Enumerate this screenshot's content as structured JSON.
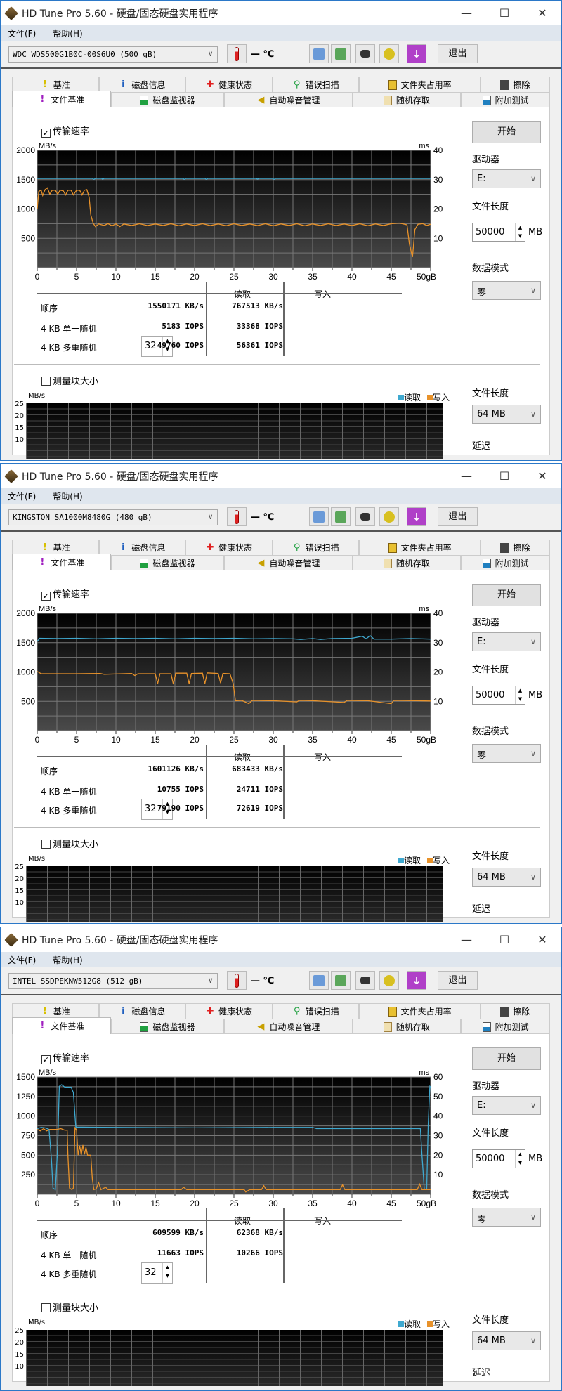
{
  "app": {
    "title": "HD Tune Pro 5.60 - 硬盘/固态硬盘实用程序",
    "menu": {
      "file": "文件(F)",
      "help": "帮助(H)"
    },
    "window_controls": {
      "minimize": "—",
      "maximize": "☐",
      "close": "✕"
    },
    "temperature": "— ℃",
    "exit": "退出",
    "tabs_row1": [
      "基准",
      "磁盘信息",
      "健康状态",
      "错误扫描",
      "文件夹占用率",
      "擦除"
    ],
    "tabs_row2": [
      "文件基准",
      "磁盘监视器",
      "自动噪音管理",
      "随机存取",
      "附加测试"
    ],
    "transfer_rate_label": "传输速率",
    "start": "开始",
    "drive_label": "驱动器",
    "drive_value": "E:",
    "file_length_label": "文件长度",
    "file_length_value": "50000",
    "file_length_unit": "MB",
    "data_mode_label": "数据模式",
    "data_mode_value": "零",
    "col_read": "读取",
    "col_write": "写入",
    "row_labels": [
      "顺序",
      "4 KB 单一随机",
      "4 KB 多重随机"
    ],
    "queue_depth": "32",
    "block_size_label": "测量块大小",
    "block_ylabel": "MB/s",
    "block_yticks": [
      "25",
      "20",
      "15",
      "10"
    ],
    "legend_read": "读取",
    "legend_write": "写入",
    "block_file_length": "64 MB",
    "latency_label": "延迟",
    "colors": {
      "read": "#3fa9d0",
      "write": "#e8922a",
      "border": "#2b78c8"
    }
  },
  "windows": [
    {
      "drive": "WDC WDS500G1B0C-00S6U0 (500 gB)",
      "seq_read": "1550171 KB/s",
      "seq_write": "767513 KB/s",
      "r4k_read": "5183 IOPS",
      "r4k_write": "33368 IOPS",
      "r4kq_read": "49760 IOPS",
      "r4kq_write": "56361 IOPS"
    },
    {
      "drive": "KINGSTON SA1000M8480G (480 gB)",
      "seq_read": "1601126 KB/s",
      "seq_write": "683433 KB/s",
      "r4k_read": "10755 IOPS",
      "r4k_write": "24711 IOPS",
      "r4kq_read": "79190 IOPS",
      "r4kq_write": "72619 IOPS"
    },
    {
      "drive": "INTEL SSDPEKNW512G8 (512 gB)",
      "seq_read": "609599 KB/s",
      "seq_write": "62368 KB/s",
      "r4k_read": "11663 IOPS",
      "r4k_write": "10266 IOPS",
      "r4kq_read": "",
      "r4kq_write": ""
    }
  ],
  "chart_data": [
    {
      "type": "line",
      "ylabel": "MB/s",
      "y2label": "ms",
      "xlabel": "gB",
      "xlim": [
        0,
        50
      ],
      "ylim": [
        0,
        2000
      ],
      "y2lim": [
        0,
        40
      ],
      "xticks": [
        "0",
        "5",
        "10",
        "15",
        "20",
        "25",
        "30",
        "35",
        "40",
        "45",
        "50gB"
      ],
      "yticks": [
        "500",
        "1000",
        "1500",
        "2000"
      ],
      "y2ticks": [
        "10",
        "20",
        "30",
        "40"
      ],
      "series": [
        {
          "name": "读取",
          "points": [
            [
              0,
              1520
            ],
            [
              7,
              1520
            ],
            [
              7.2,
              1505
            ],
            [
              7.4,
              1520
            ],
            [
              8.2,
              1520
            ],
            [
              8.3,
              1508
            ],
            [
              8.5,
              1520
            ],
            [
              18.5,
              1520
            ],
            [
              18.7,
              1505
            ],
            [
              18.9,
              1520
            ],
            [
              21.3,
              1520
            ],
            [
              21.5,
              1505
            ],
            [
              21.7,
              1520
            ],
            [
              27.8,
              1520
            ],
            [
              28,
              1510
            ],
            [
              28.2,
              1520
            ],
            [
              29.9,
              1520
            ],
            [
              30.1,
              1505
            ],
            [
              30.3,
              1520
            ],
            [
              50,
              1520
            ]
          ]
        },
        {
          "name": "写入",
          "points": [
            [
              0,
              1000
            ],
            [
              0.2,
              1300
            ],
            [
              0.5,
              1320
            ],
            [
              0.7,
              1230
            ],
            [
              1,
              1330
            ],
            [
              1.3,
              1360
            ],
            [
              1.6,
              1250
            ],
            [
              1.9,
              1320
            ],
            [
              2.3,
              1320
            ],
            [
              2.6,
              1250
            ],
            [
              2.9,
              1320
            ],
            [
              3.3,
              1310
            ],
            [
              3.6,
              1240
            ],
            [
              3.9,
              1320
            ],
            [
              4.3,
              1320
            ],
            [
              4.6,
              1240
            ],
            [
              5,
              1320
            ],
            [
              5.4,
              1320
            ],
            [
              5.7,
              1240
            ],
            [
              6,
              1320
            ],
            [
              6.3,
              1330
            ],
            [
              6.6,
              1200
            ],
            [
              6.8,
              900
            ],
            [
              7.1,
              760
            ],
            [
              7.4,
              700
            ],
            [
              7.8,
              745
            ],
            [
              8.5,
              720
            ],
            [
              9,
              750
            ],
            [
              9.5,
              715
            ],
            [
              10,
              745
            ],
            [
              10.5,
              700
            ],
            [
              11,
              745
            ],
            [
              12,
              720
            ],
            [
              13,
              748
            ],
            [
              14,
              718
            ],
            [
              15,
              745
            ],
            [
              16,
              720
            ],
            [
              17,
              748
            ],
            [
              18,
              715
            ],
            [
              19,
              745
            ],
            [
              20,
              720
            ],
            [
              21,
              748
            ],
            [
              22,
              718
            ],
            [
              23,
              745
            ],
            [
              24,
              715
            ],
            [
              25,
              748
            ],
            [
              26,
              720
            ],
            [
              27,
              745
            ],
            [
              28,
              718
            ],
            [
              29,
              748
            ],
            [
              30,
              715
            ],
            [
              31,
              745
            ],
            [
              32,
              720
            ],
            [
              33,
              748
            ],
            [
              34,
              715
            ],
            [
              35,
              745
            ],
            [
              36,
              720
            ],
            [
              37,
              748
            ],
            [
              38,
              718
            ],
            [
              39,
              745
            ],
            [
              40,
              720
            ],
            [
              41,
              748
            ],
            [
              42,
              715
            ],
            [
              43,
              745
            ],
            [
              44,
              720
            ],
            [
              45,
              748
            ],
            [
              46,
              760
            ],
            [
              47,
              730
            ],
            [
              47.3,
              400
            ],
            [
              47.7,
              180
            ],
            [
              48,
              650
            ],
            [
              48.4,
              740
            ],
            [
              49,
              750
            ],
            [
              49.5,
              720
            ],
            [
              50,
              740
            ]
          ]
        }
      ]
    },
    {
      "type": "line",
      "ylabel": "MB/s",
      "y2label": "ms",
      "xlabel": "gB",
      "xlim": [
        0,
        50
      ],
      "ylim": [
        0,
        2000
      ],
      "y2lim": [
        0,
        40
      ],
      "xticks": [
        "0",
        "5",
        "10",
        "15",
        "20",
        "25",
        "30",
        "35",
        "40",
        "45",
        "50gB"
      ],
      "yticks": [
        "500",
        "1000",
        "1500",
        "2000"
      ],
      "y2ticks": [
        "10",
        "20",
        "30",
        "40"
      ],
      "series": [
        {
          "name": "读取",
          "points": [
            [
              0,
              1520
            ],
            [
              0.3,
              1575
            ],
            [
              2.5,
              1570
            ],
            [
              5,
              1575
            ],
            [
              7.5,
              1565
            ],
            [
              10,
              1575
            ],
            [
              12.5,
              1570
            ],
            [
              15,
              1575
            ],
            [
              17.5,
              1565
            ],
            [
              20,
              1575
            ],
            [
              22.5,
              1570
            ],
            [
              25,
              1575
            ],
            [
              27.5,
              1565
            ],
            [
              30,
              1570
            ],
            [
              32.5,
              1565
            ],
            [
              33.5,
              1555
            ],
            [
              35,
              1570
            ],
            [
              36,
              1555
            ],
            [
              37.5,
              1570
            ],
            [
              40,
              1575
            ],
            [
              41.3,
              1610
            ],
            [
              41.8,
              1565
            ],
            [
              42.3,
              1620
            ],
            [
              42.8,
              1560
            ],
            [
              45,
              1560
            ],
            [
              47.5,
              1570
            ],
            [
              50,
              1560
            ]
          ]
        },
        {
          "name": "写入",
          "points": [
            [
              0,
              1010
            ],
            [
              0.5,
              970
            ],
            [
              5,
              970
            ],
            [
              8,
              975
            ],
            [
              8.5,
              960
            ],
            [
              12,
              975
            ],
            [
              12.4,
              940
            ],
            [
              12.8,
              970
            ],
            [
              15,
              970
            ],
            [
              15.3,
              800
            ],
            [
              15.6,
              970
            ],
            [
              17,
              970
            ],
            [
              17.3,
              790
            ],
            [
              17.6,
              980
            ],
            [
              19,
              980
            ],
            [
              19.3,
              800
            ],
            [
              19.6,
              975
            ],
            [
              21,
              980
            ],
            [
              21.3,
              800
            ],
            [
              21.6,
              985
            ],
            [
              23,
              975
            ],
            [
              23.3,
              810
            ],
            [
              23.6,
              975
            ],
            [
              24.5,
              970
            ],
            [
              24.9,
              800
            ],
            [
              25.2,
              510
            ],
            [
              26,
              515
            ],
            [
              26.9,
              460
            ],
            [
              27.3,
              515
            ],
            [
              30,
              510
            ],
            [
              33,
              490
            ],
            [
              33.3,
              515
            ],
            [
              35,
              510
            ],
            [
              39,
              480
            ],
            [
              39.4,
              515
            ],
            [
              42,
              510
            ],
            [
              45,
              460
            ],
            [
              45.3,
              515
            ],
            [
              48,
              510
            ],
            [
              50,
              505
            ]
          ]
        }
      ]
    },
    {
      "type": "line",
      "ylabel": "MB/s",
      "y2label": "ms",
      "xlabel": "gB",
      "xlim": [
        0,
        50
      ],
      "ylim": [
        0,
        1500
      ],
      "y2lim": [
        0,
        60
      ],
      "xticks": [
        "0",
        "5",
        "10",
        "15",
        "20",
        "25",
        "30",
        "35",
        "40",
        "45",
        "50gB"
      ],
      "yticks": [
        "250",
        "500",
        "750",
        "1000",
        "1250",
        "1500"
      ],
      "y2ticks": [
        "10",
        "20",
        "30",
        "40",
        "50",
        "60"
      ],
      "series": [
        {
          "name": "读取",
          "points": [
            [
              0,
              840
            ],
            [
              0.5,
              855
            ],
            [
              1,
              850
            ],
            [
              1.5,
              830
            ],
            [
              1.8,
              450
            ],
            [
              2,
              80
            ],
            [
              2.3,
              60
            ],
            [
              2.6,
              600
            ],
            [
              2.8,
              1380
            ],
            [
              3.1,
              1400
            ],
            [
              3.5,
              1370
            ],
            [
              4.3,
              1370
            ],
            [
              4.6,
              1300
            ],
            [
              4.8,
              1000
            ],
            [
              4.9,
              860
            ],
            [
              10,
              855
            ],
            [
              20,
              850
            ],
            [
              30,
              855
            ],
            [
              35,
              855
            ],
            [
              35.5,
              840
            ],
            [
              48.7,
              840
            ],
            [
              48.9,
              500
            ],
            [
              49.2,
              60
            ],
            [
              49.5,
              60
            ],
            [
              49.7,
              900
            ],
            [
              49.9,
              1380
            ],
            [
              50,
              1370
            ]
          ]
        },
        {
          "name": "写入",
          "points": [
            [
              0,
              830
            ],
            [
              0.4,
              810
            ],
            [
              0.8,
              840
            ],
            [
              1.2,
              810
            ],
            [
              1.6,
              830
            ],
            [
              2.5,
              830
            ],
            [
              3,
              840
            ],
            [
              3.5,
              820
            ],
            [
              3.8,
              820
            ],
            [
              3.9,
              500
            ],
            [
              4.1,
              80
            ],
            [
              4.4,
              60
            ],
            [
              4.6,
              80
            ],
            [
              4.8,
              850
            ],
            [
              5,
              820
            ],
            [
              5.2,
              500
            ],
            [
              5.4,
              620
            ],
            [
              5.6,
              500
            ],
            [
              5.8,
              630
            ],
            [
              6,
              510
            ],
            [
              6.2,
              600
            ],
            [
              6.4,
              500
            ],
            [
              6.8,
              500
            ],
            [
              7,
              200
            ],
            [
              7.2,
              60
            ],
            [
              7.5,
              70
            ],
            [
              7.8,
              150
            ],
            [
              8.1,
              60
            ],
            [
              8.7,
              90
            ],
            [
              9,
              60
            ],
            [
              18.3,
              60
            ],
            [
              18.6,
              90
            ],
            [
              19,
              60
            ],
            [
              26.3,
              60
            ],
            [
              26.5,
              30
            ],
            [
              27,
              60
            ],
            [
              28.5,
              60
            ],
            [
              28.8,
              110
            ],
            [
              29.1,
              60
            ],
            [
              38.5,
              60
            ],
            [
              38.8,
              120
            ],
            [
              39.1,
              60
            ],
            [
              48.3,
              60
            ],
            [
              48.6,
              130
            ],
            [
              48.9,
              60
            ],
            [
              50,
              60
            ]
          ]
        }
      ]
    }
  ]
}
